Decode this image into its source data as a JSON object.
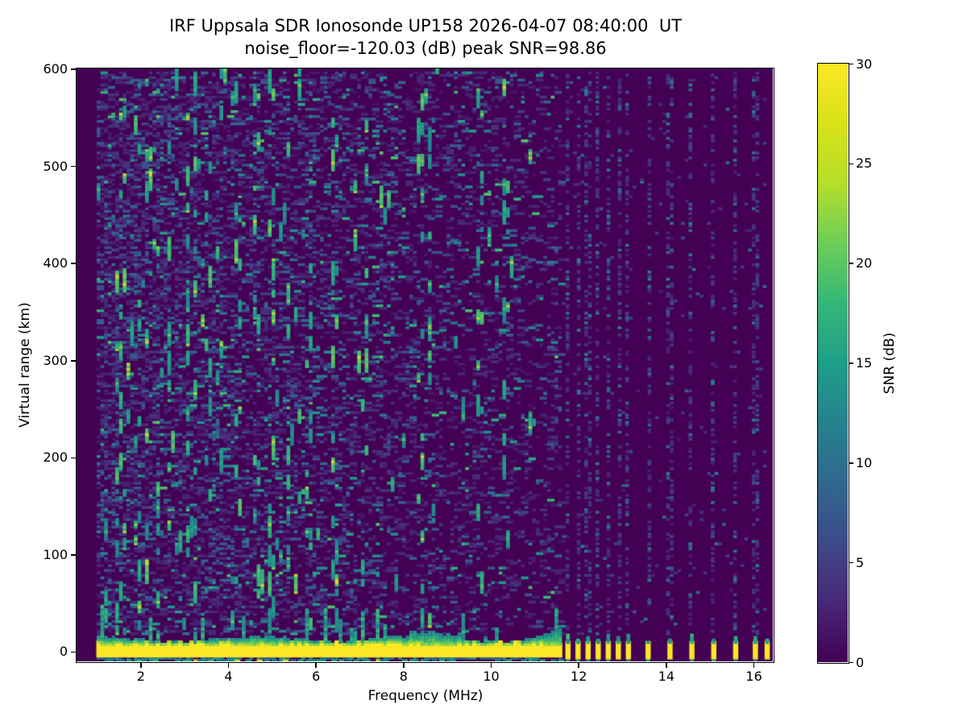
{
  "figure": {
    "title_line1": "IRF Uppsala SDR Ionosonde UP158 2026-04-07 08:40:00  UT",
    "title_line2": "noise_floor=-120.03 (dB) peak SNR=98.86"
  },
  "chart_data": {
    "type": "heatmap",
    "title": "IRF Uppsala SDR Ionosonde UP158 2026-04-07 08:40:00  UT",
    "subtitle": "noise_floor=-120.03 (dB) peak SNR=98.86",
    "station": "UP158",
    "timestamp_ut": "2026-04-07 08:40:00",
    "noise_floor_db": -120.03,
    "peak_snr_db": 98.86,
    "xlabel": "Frequency (MHz)",
    "ylabel": "Virtual range (km)",
    "colorbar_label": "SNR (dB)",
    "colormap": "viridis",
    "clim": [
      0,
      30
    ],
    "xlim": [
      0.54,
      16.44
    ],
    "ylim": [
      -10,
      600.5
    ],
    "xticks": [
      2,
      4,
      6,
      8,
      10,
      12,
      14,
      16
    ],
    "yticks": [
      0,
      100,
      200,
      300,
      400,
      500,
      600
    ],
    "colorbar_ticks": [
      0,
      5,
      10,
      15,
      20,
      25,
      30
    ],
    "grid": false,
    "legend_position": "colorbar-right",
    "heatmap_model": {
      "sweep_start_mhz": 1.0,
      "sweep_end_mhz": 16.3,
      "continuous_until_mhz": 11.62,
      "freq_step_mhz": 0.085,
      "range_step_km": 2.5,
      "ground_echo_band_km": [
        -6,
        9
      ],
      "ground_echo_snr_db": 30,
      "discrete_tx_freqs_mhz": [
        11.72,
        11.95,
        12.18,
        12.41,
        12.64,
        12.87,
        13.1,
        13.55,
        14.05,
        14.55,
        15.05,
        15.55,
        16.0,
        16.27
      ],
      "active_noise_columns_mhz": [
        1.45,
        1.6,
        1.9,
        2.1,
        2.35,
        2.6,
        3.05,
        3.2,
        3.5,
        4.2,
        4.6,
        4.95,
        5.35,
        5.8,
        6.4,
        7.1,
        8.35,
        8.55,
        9.7,
        10.3
      ],
      "noise_density_at_1mhz": 0.4,
      "noise_density_min": 0.14,
      "noise_density_slope_per_mhz": -0.026,
      "discrete_column_noise_density": 0.34,
      "render_seed": 1337
    },
    "viridis_anchors": [
      [
        0.0,
        "#440154"
      ],
      [
        0.1,
        "#482878"
      ],
      [
        0.2,
        "#3e4a89"
      ],
      [
        0.3,
        "#31688e"
      ],
      [
        0.4,
        "#26828e"
      ],
      [
        0.5,
        "#1f9e89"
      ],
      [
        0.6,
        "#35b779"
      ],
      [
        0.7,
        "#6ece58"
      ],
      [
        0.8,
        "#b5de2b"
      ],
      [
        0.9,
        "#d8e219"
      ],
      [
        1.0,
        "#fde725"
      ]
    ]
  }
}
